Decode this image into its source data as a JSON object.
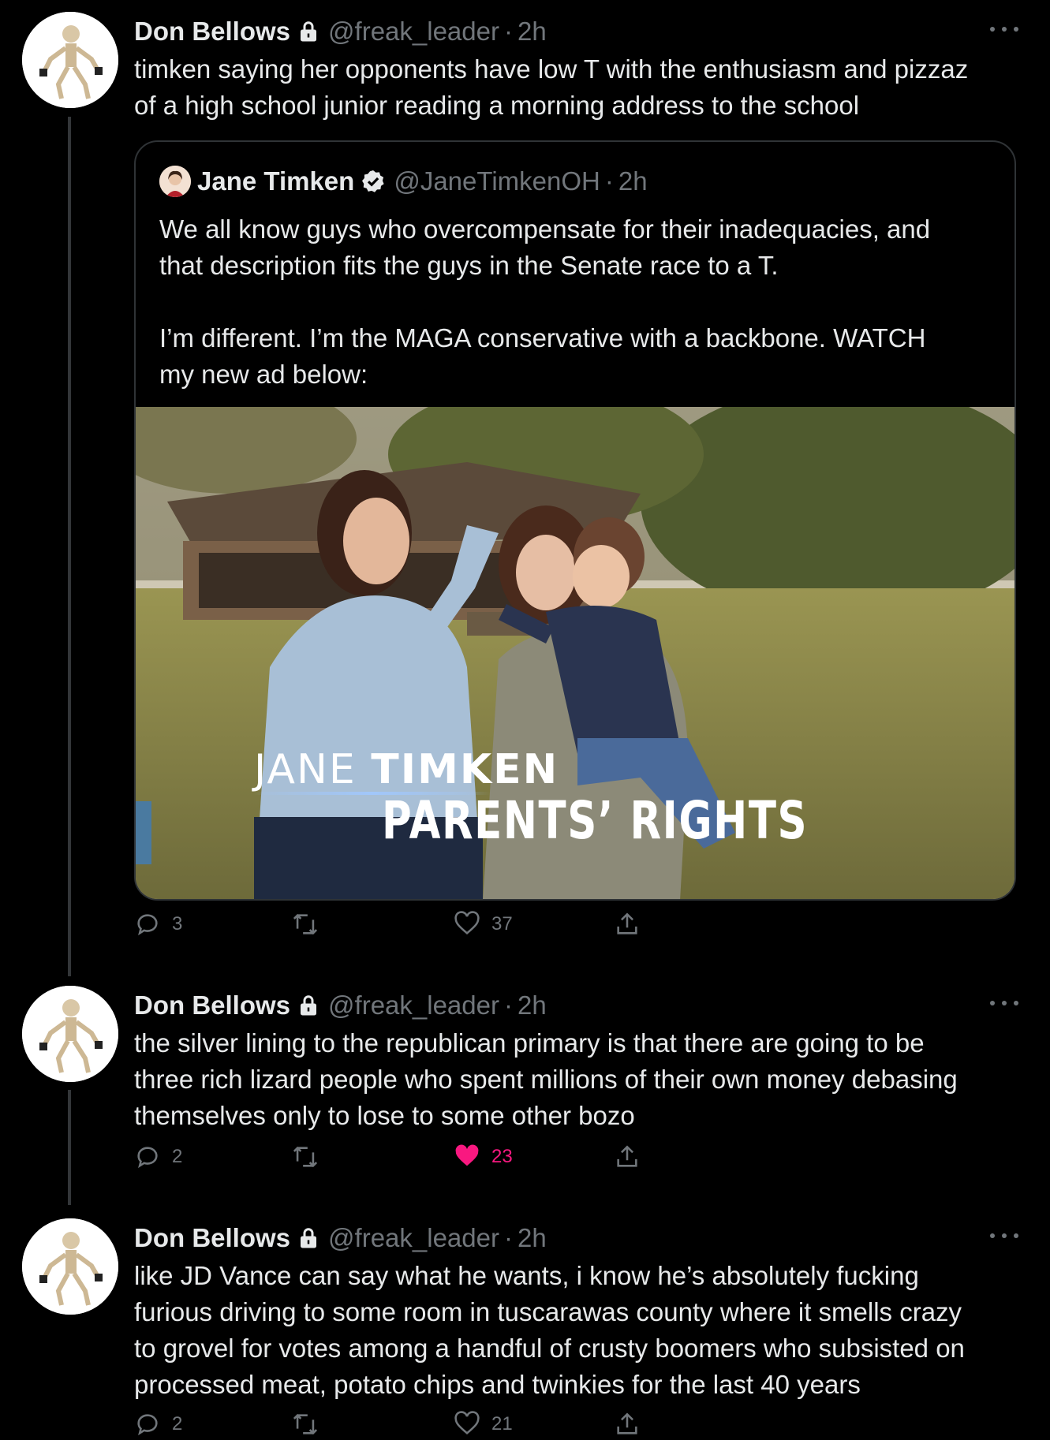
{
  "tweets": [
    {
      "author": "Don Bellows",
      "handle": "@freak_leader",
      "separator": "·",
      "time": "2h",
      "lines": [
        "timken saying her opponents have low T with the enthusiasm and pizzaz",
        "of a high school junior reading a morning address to the school"
      ],
      "quote": {
        "author": "Jane Timken",
        "handle": "@JaneTimkenOH",
        "separator": "·",
        "time": "2h",
        "lines": [
          "We all know guys who overcompensate for their inadequacies, and",
          "that description fits the guys in the Senate race to a T."
        ],
        "lines2": [
          "I’m different. I’m the MAGA conservative with a backbone. WATCH",
          "my new ad below:"
        ],
        "media": {
          "caption_first": "JANE ",
          "caption_last": "TIMKEN",
          "caption_sub": "PARENTS’ RIGHTS"
        }
      },
      "replies": "3",
      "retweets": "",
      "likes": "37"
    },
    {
      "author": "Don Bellows",
      "handle": "@freak_leader",
      "separator": "·",
      "time": "2h",
      "lines": [
        "the silver lining to the republican primary is that there are going to be",
        "three rich lizard people who spent millions of their own money debasing",
        "themselves only to lose to some other bozo"
      ],
      "replies": "2",
      "retweets": "",
      "likes": "23",
      "liked": true
    },
    {
      "author": "Don Bellows",
      "handle": "@freak_leader",
      "separator": "·",
      "time": "2h",
      "lines": [
        "like JD Vance can say what he wants, i know he’s absolutely fucking",
        "furious driving to some room in tuscarawas county where it smells crazy",
        "to grovel for votes among a handful of crusty boomers who subsisted on",
        "processed meat, potato chips and twinkies for the last 40 years"
      ],
      "replies": "2",
      "retweets": "",
      "likes": "21"
    }
  ],
  "icons": {
    "reply": "reply-icon",
    "retweet": "retweet-icon",
    "like": "heart-icon",
    "share": "share-icon",
    "lock": "lock-icon",
    "verified": "verified-icon",
    "more": "more-icon"
  },
  "colors": {
    "background": "#000000",
    "text": "#e7e9ea",
    "secondary": "#71767b",
    "like_active": "#f91880",
    "border": "#2f3336"
  }
}
